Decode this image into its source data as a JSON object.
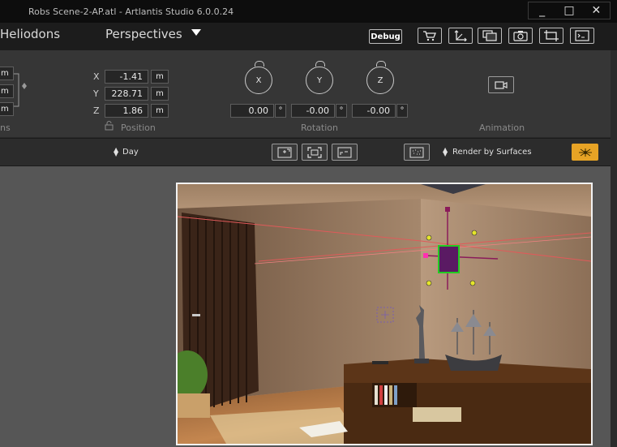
{
  "window": {
    "title": "Robs Scene-2-AP.atl - Artlantis Studio 6.0.0.24",
    "controls": [
      "_",
      "□",
      "✕"
    ]
  },
  "menu": {
    "items": [
      "Heliodons",
      "Perspectives"
    ],
    "debug_label": "Debug",
    "tools": [
      "cart-icon",
      "axis-icon",
      "gallery-icon",
      "camera-icon",
      "crop-icon",
      "console-icon"
    ]
  },
  "inspector": {
    "left_fields": [
      "m",
      "m",
      "m"
    ],
    "left_section_partial": "ns",
    "position": {
      "x_label": "X",
      "x_value": "-1.41",
      "x_unit": "m",
      "y_label": "Y",
      "y_value": "228.71",
      "y_unit": "m",
      "z_label": "Z",
      "z_value": "1.86",
      "z_unit": "m",
      "section_label": "Position"
    },
    "rotation": {
      "dials": [
        "X",
        "Y",
        "Z"
      ],
      "values": [
        "0.00",
        "-0.00",
        "-0.00"
      ],
      "unit": "°",
      "section_label": "Rotation"
    },
    "animation": {
      "section_label": "Animation"
    }
  },
  "toolbar2": {
    "day_label": "Day",
    "render_mode_label": "Render by Surfaces"
  },
  "colors": {
    "accent": "#e7a325",
    "selection": "#22cc22",
    "handle": "#e5e52a"
  }
}
